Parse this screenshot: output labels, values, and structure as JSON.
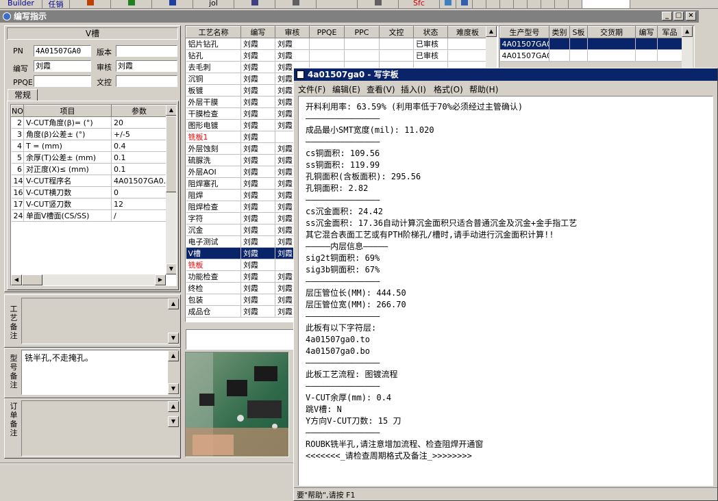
{
  "topbar": {
    "items": [
      "Builder",
      "任销",
      "",
      "",
      "",
      "jol",
      "",
      "",
      "",
      "",
      "",
      "Sfc",
      "",
      "",
      "",
      "",
      "",
      "",
      "",
      ""
    ]
  },
  "window": {
    "title": "编写指示"
  },
  "left": {
    "header": "V槽",
    "fields": {
      "pn_label": "PN",
      "pn_value": "4A01507GA0",
      "version_label": "版本",
      "version_value": "",
      "author_label": "编写",
      "author_value": "刘霞",
      "reviewer_label": "审核",
      "reviewer_value": "刘霞",
      "ppqe_label": "PPQE",
      "ppqe_value": "",
      "doc_label": "文控",
      "doc_value": ""
    },
    "tab": "常规",
    "param_table": {
      "headers": [
        "NO",
        "项目",
        "参数"
      ],
      "rows": [
        [
          "2",
          "V-CUT角度(β)=  (°)",
          "20"
        ],
        [
          "3",
          "角度(β)公差±  (°)",
          "+/-5"
        ],
        [
          "4",
          "T =  (mm)",
          "0.4"
        ],
        [
          "5",
          "余厚(T)公差±  (mm)",
          "0.1"
        ],
        [
          "6",
          "对正度(X)≤ (mm)",
          "0.1"
        ],
        [
          "14",
          "V-CUT程序名",
          "4A01507GA0.CS"
        ],
        [
          "16",
          "V-CUT横刀数",
          "0"
        ],
        [
          "17",
          "V-CUT竖刀数",
          "12"
        ],
        [
          "24",
          "单面V槽面(CS/SS)",
          "/"
        ]
      ]
    },
    "notes": [
      {
        "label": "工艺备注",
        "text": ""
      },
      {
        "label": "型号备注",
        "text": "铣半孔,不走掩孔。"
      },
      {
        "label": "订单备注",
        "text": ""
      }
    ]
  },
  "process_table": {
    "headers": [
      "工艺名称",
      "编写",
      "审核",
      "PPQE",
      "PPC",
      "文控",
      "状态",
      "难度板"
    ],
    "rows": [
      {
        "name": "铝片钻孔",
        "author": "刘霞",
        "reviewer": "刘霞",
        "status": "已审核",
        "red": false,
        "selected": false
      },
      {
        "name": "钻孔",
        "author": "刘霞",
        "reviewer": "刘霞",
        "status": "已审核",
        "red": false,
        "selected": false
      },
      {
        "name": "去毛刺",
        "author": "刘霞",
        "reviewer": "刘霞",
        "status": "",
        "red": false,
        "selected": false
      },
      {
        "name": "沉铜",
        "author": "刘霞",
        "reviewer": "刘霞",
        "status": "",
        "red": false,
        "selected": false
      },
      {
        "name": "板镀",
        "author": "刘霞",
        "reviewer": "刘霞",
        "status": "",
        "red": false,
        "selected": false
      },
      {
        "name": "外层干膜",
        "author": "刘霞",
        "reviewer": "刘霞",
        "status": "",
        "red": false,
        "selected": false
      },
      {
        "name": "干膜检查",
        "author": "刘霞",
        "reviewer": "刘霞",
        "status": "",
        "red": false,
        "selected": false
      },
      {
        "name": "图形电镀",
        "author": "刘霞",
        "reviewer": "刘霞",
        "status": "",
        "red": false,
        "selected": false
      },
      {
        "name": "铣板1",
        "author": "刘霞",
        "reviewer": "",
        "status": "",
        "red": true,
        "selected": false
      },
      {
        "name": "外层蚀刻",
        "author": "刘霞",
        "reviewer": "刘霞",
        "status": "",
        "red": false,
        "selected": false
      },
      {
        "name": "硫脲洗",
        "author": "刘霞",
        "reviewer": "刘霞",
        "status": "",
        "red": false,
        "selected": false
      },
      {
        "name": "外层AOI",
        "author": "刘霞",
        "reviewer": "刘霞",
        "status": "",
        "red": false,
        "selected": false
      },
      {
        "name": "阻焊塞孔",
        "author": "刘霞",
        "reviewer": "刘霞",
        "status": "",
        "red": false,
        "selected": false
      },
      {
        "name": "阻焊",
        "author": "刘霞",
        "reviewer": "刘霞",
        "status": "",
        "red": false,
        "selected": false
      },
      {
        "name": "阻焊检查",
        "author": "刘霞",
        "reviewer": "刘霞",
        "status": "",
        "red": false,
        "selected": false
      },
      {
        "name": "字符",
        "author": "刘霞",
        "reviewer": "刘霞",
        "status": "",
        "red": false,
        "selected": false
      },
      {
        "name": "沉金",
        "author": "刘霞",
        "reviewer": "刘霞",
        "status": "",
        "red": false,
        "selected": false
      },
      {
        "name": "电子测试",
        "author": "刘霞",
        "reviewer": "刘霞",
        "status": "",
        "red": false,
        "selected": false
      },
      {
        "name": "V槽",
        "author": "刘霞",
        "reviewer": "刘霞",
        "status": "",
        "red": false,
        "selected": true
      },
      {
        "name": "铣板",
        "author": "刘霞",
        "reviewer": "",
        "status": "",
        "red": true,
        "selected": false
      },
      {
        "name": "功能检查",
        "author": "刘霞",
        "reviewer": "刘霞",
        "status": "",
        "red": false,
        "selected": false
      },
      {
        "name": "终检",
        "author": "刘霞",
        "reviewer": "刘霞",
        "status": "",
        "red": false,
        "selected": false
      },
      {
        "name": "包装",
        "author": "刘霞",
        "reviewer": "刘霞",
        "status": "",
        "red": false,
        "selected": false
      },
      {
        "name": "成品仓",
        "author": "刘霞",
        "reviewer": "刘霞",
        "status": "",
        "red": false,
        "selected": false
      }
    ]
  },
  "model_table": {
    "headers": [
      "生产型号",
      "类别",
      "S板",
      "交货期",
      "编写",
      "军品"
    ],
    "rows": [
      [
        "4A01507GA0",
        "",
        "",
        "",
        "",
        ""
      ],
      [
        "4A01507GA0",
        "",
        "",
        "",
        "",
        ""
      ]
    ]
  },
  "notepad": {
    "title": "4a01507ga0 - 写字板",
    "menu": [
      "文件(F)",
      "编辑(E)",
      "查看(V)",
      "插入(I)",
      "格式(O)",
      "帮助(H)"
    ],
    "lines": [
      "开料利用率: 63.59% (利用率低于70%必须经过主管确认)",
      "———————————————",
      "成品最小SMT宽度(mil): 11.020",
      "———————————————",
      "cs铜面积: 109.56",
      "ss铜面积: 119.99",
      "孔铜面积(含板面积): 295.56",
      "孔铜面积: 2.82",
      "———————————————",
      "cs沉金面积: 24.42",
      "ss沉金面积: 17.36自动计算沉金面积只适合普通沉金及沉金+金手指工艺",
      "其它混合表面工艺或有PTH阶梯孔/槽时,请手动进行沉金面积计算!!",
      "—————内层信息—————",
      "sig2t铜面积: 69%",
      "sig3b铜面积: 67%",
      "———————————————",
      "层压管位长(MM): 444.50",
      "层压管位宽(MM): 266.70",
      "———————————————",
      "此板有以下字符层:",
      "4a01507ga0.to",
      "4a01507ga0.bo",
      "———————————————",
      "此板工艺流程: 图镀流程",
      "———————————————",
      "V-CUT余厚(mm): 0.4",
      "跳V槽: N",
      "Y方向V-CUT刀数: 15 刀",
      "———————————————",
      "ROUBK铣半孔,请注意增加流程、检查阻焊开通窗",
      "<<<<<<<_请检查周期格式及备注_>>>>>>>>"
    ],
    "status": "要\"帮助\",请按 F1"
  }
}
